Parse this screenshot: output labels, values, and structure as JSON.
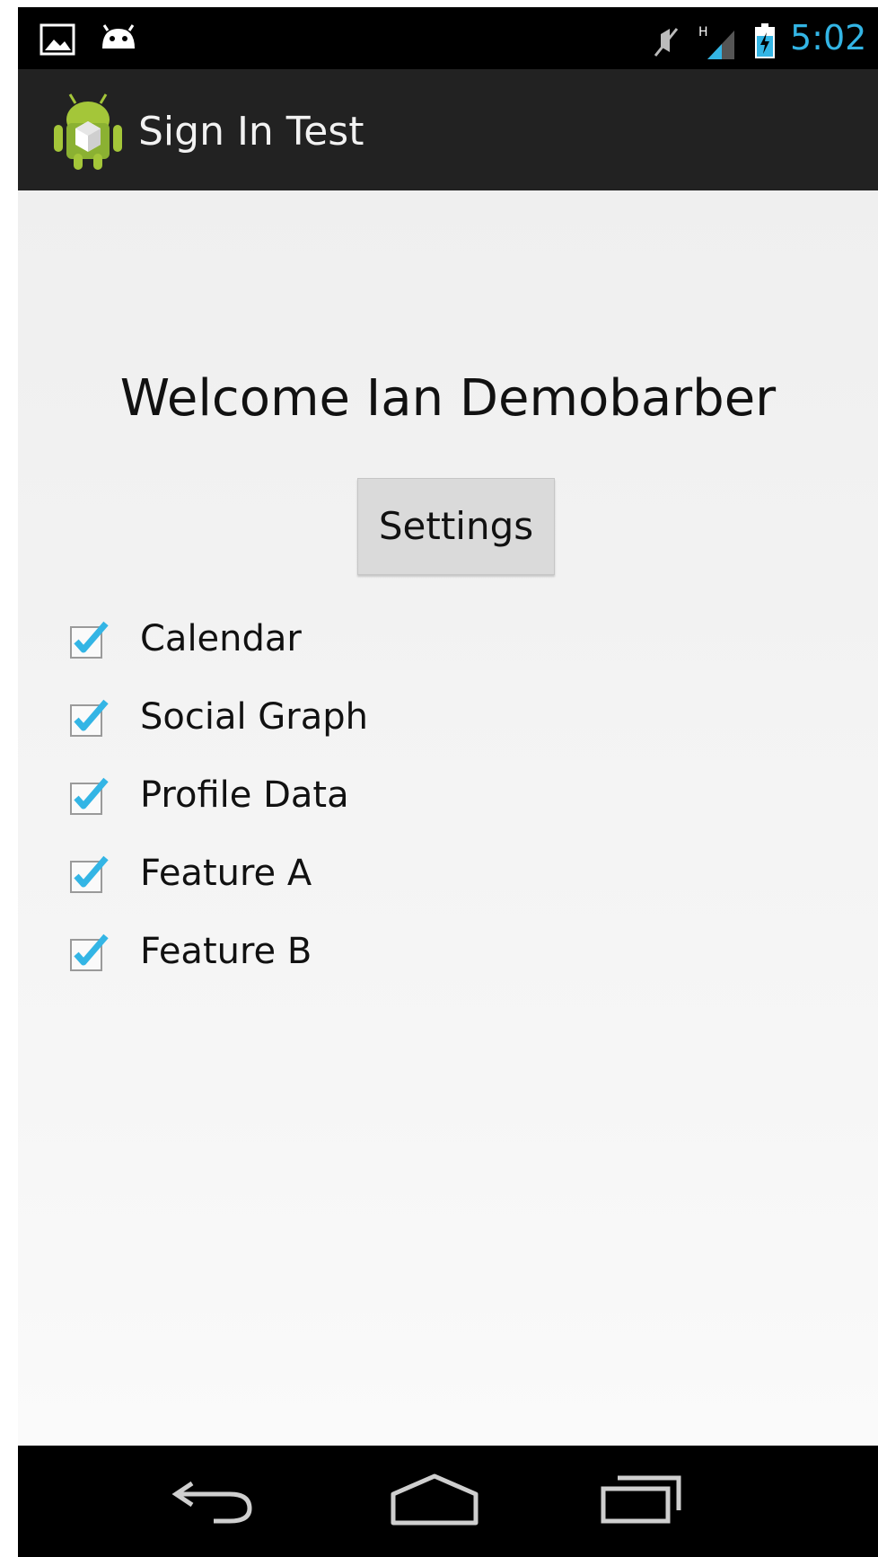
{
  "status_bar": {
    "time": "5:02",
    "network_letter": "H",
    "icons": [
      "gallery-icon",
      "android-notification-icon",
      "mute-icon",
      "signal-icon",
      "battery-icon"
    ]
  },
  "action_bar": {
    "title": "Sign In Test",
    "icon": "android-app-icon"
  },
  "main": {
    "welcome_text": "Welcome Ian Demobarber",
    "settings_label": "Settings",
    "checkboxes": [
      {
        "label": "Calendar",
        "checked": true
      },
      {
        "label": "Social Graph",
        "checked": true
      },
      {
        "label": "Profile Data",
        "checked": true
      },
      {
        "label": "Feature A",
        "checked": true
      },
      {
        "label": "Feature B",
        "checked": true
      }
    ]
  },
  "nav_bar": {
    "buttons": [
      "back-icon",
      "home-icon",
      "recent-apps-icon"
    ]
  },
  "colors": {
    "accent": "#33b5e5",
    "status_bar": "#000000",
    "action_bar": "#222222",
    "background": "#f3f3f3",
    "checkmark": "#33b5e5"
  }
}
